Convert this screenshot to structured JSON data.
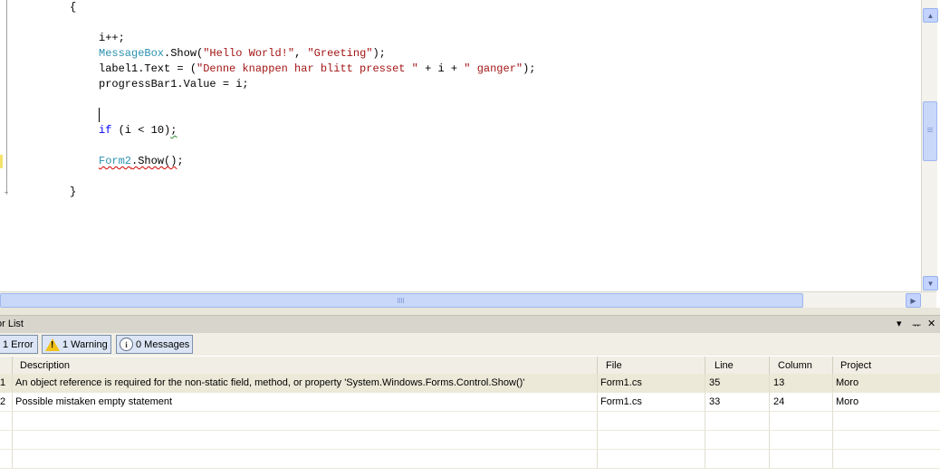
{
  "editor": {
    "lines": {
      "open_brace": "{",
      "inc": "i++;",
      "mb_type": "MessageBox",
      "mb_call": ".Show(",
      "mb_str1": "\"Hello World!\"",
      "mb_sep": ", ",
      "mb_str2": "\"Greeting\"",
      "mb_end": ");",
      "label_pre": "label1.Text = (",
      "label_str1": "\"Denne knappen har blitt presset \"",
      "label_mid": " + i + ",
      "label_str2": "\" ganger\"",
      "label_end": ");",
      "progress": "progressBar1.Value = i;",
      "if_kw": "if",
      "if_cond": " (i < 10)",
      "if_semi": ";",
      "form_type": "Form2",
      "form_call": ".Show()",
      "form_semi": ";",
      "close_brace": "}"
    },
    "vscroll": {
      "up_icon": "▲",
      "down_icon": "▼"
    },
    "hscroll": {
      "right_icon": "▶"
    }
  },
  "error_list": {
    "title": "or List",
    "header_icons": {
      "dropdown": "▾",
      "pin": "ᅲ",
      "close": "✕"
    },
    "filters": {
      "errors": "1 Error",
      "warnings": "1 Warning",
      "messages": "0 Messages",
      "warning_glyph": "!",
      "info_glyph": "i"
    },
    "columns": [
      "Description",
      "File",
      "Line",
      "Column",
      "Project"
    ],
    "rows": [
      {
        "num": "1",
        "description": "An object reference is required for the non-static field, method, or property 'System.Windows.Forms.Control.Show()'",
        "file": "Form1.cs",
        "line": "35",
        "column": "13",
        "project": "Moro"
      },
      {
        "num": "2",
        "description": "Possible mistaken empty statement",
        "file": "Form1.cs",
        "line": "33",
        "column": "24",
        "project": "Moro"
      }
    ]
  }
}
